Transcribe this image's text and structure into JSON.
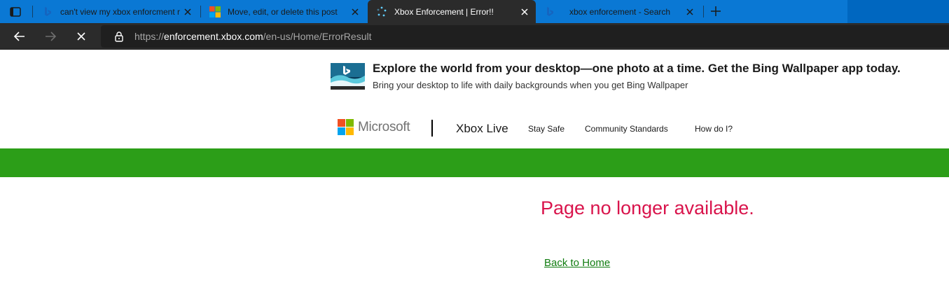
{
  "tabs": [
    {
      "title": "can't view my xbox enforcment r",
      "icon": "bing-icon",
      "active": false
    },
    {
      "title": "Move, edit, or delete this post",
      "icon": "microsoft-logo-icon",
      "active": false
    },
    {
      "title": "Xbox Enforcement | Error!!",
      "icon": "loading-spinner-icon",
      "active": true
    },
    {
      "title": "xbox enforcement - Search",
      "icon": "bing-icon",
      "active": false
    }
  ],
  "address_bar": {
    "protocol": "https://",
    "domain": "enforcement.xbox.com",
    "path": "/en-us/Home/ErrorResult"
  },
  "banner": {
    "title": "Explore the world from your desktop—one photo at a time. Get the Bing Wallpaper app today.",
    "subtitle": "Bring your desktop to life with daily backgrounds when you get Bing Wallpaper"
  },
  "header": {
    "brand": "Microsoft",
    "product": "Xbox Live",
    "nav": [
      "Stay Safe",
      "Community Standards",
      "How do I?"
    ]
  },
  "main": {
    "error_title": "Page no longer available.",
    "back_link": "Back to Home"
  },
  "colors": {
    "accent_green": "#2c9e18",
    "error_red": "#d9144c",
    "link_green": "#107c10",
    "tab_strip": "#0a78d4"
  }
}
